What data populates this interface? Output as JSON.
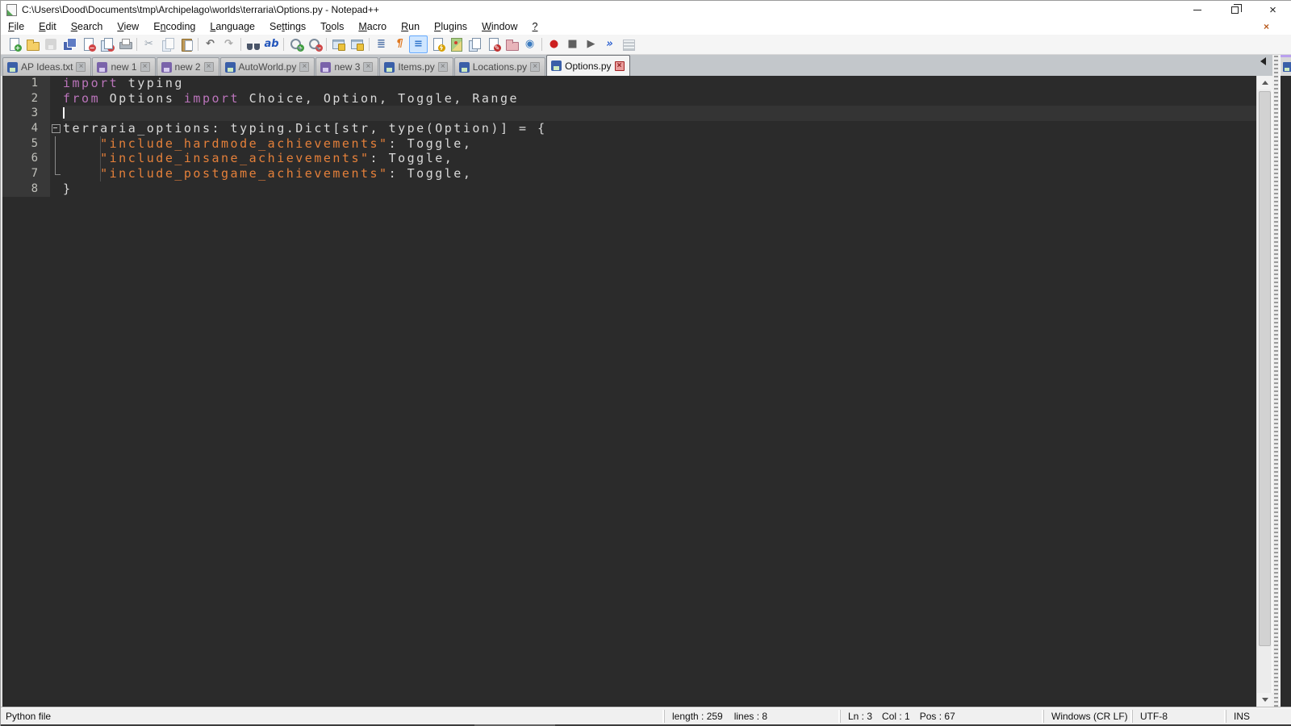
{
  "window": {
    "title": "C:\\Users\\Dood\\Documents\\tmp\\Archipelago\\worlds\\terraria\\Options.py - Notepad++"
  },
  "menu": {
    "items": [
      {
        "label": "File",
        "m": 0
      },
      {
        "label": "Edit",
        "m": 0
      },
      {
        "label": "Search",
        "m": 0
      },
      {
        "label": "View",
        "m": 0
      },
      {
        "label": "Encoding",
        "m": 1
      },
      {
        "label": "Language",
        "m": 0
      },
      {
        "label": "Settings",
        "m": 2
      },
      {
        "label": "Tools",
        "m": 1
      },
      {
        "label": "Macro",
        "m": 0
      },
      {
        "label": "Run",
        "m": 0
      },
      {
        "label": "Plugins",
        "m": 0
      },
      {
        "label": "Window",
        "m": 0
      },
      {
        "label": "?",
        "m": 0
      }
    ],
    "close_x": "×"
  },
  "toolbar": {
    "groups": [
      [
        {
          "id": "new-file",
          "k": "page",
          "b": "+",
          "bc": "#3f9e3f"
        },
        {
          "id": "open-file",
          "k": "folder"
        },
        {
          "id": "save",
          "k": "floppy gray",
          "disabled": true
        },
        {
          "id": "save-all",
          "k": "floppies"
        },
        {
          "id": "close-file",
          "k": "page",
          "b": "−",
          "bc": "#d04545"
        },
        {
          "id": "close-all-files",
          "k": "pages",
          "b": "−",
          "bc": "#d04545"
        },
        {
          "id": "print",
          "k": "printer"
        }
      ],
      [
        {
          "id": "cut",
          "k": "glyph",
          "g": "✂",
          "col": "#98a4b0"
        },
        {
          "id": "copy",
          "k": "pages",
          "disabled": true
        },
        {
          "id": "paste",
          "k": "clipboard"
        }
      ],
      [
        {
          "id": "undo",
          "k": "glyph",
          "g": "↶",
          "col": "#6e6e6e"
        },
        {
          "id": "redo",
          "k": "glyph",
          "g": "↷",
          "col": "#aaaaaa"
        }
      ],
      [
        {
          "id": "find",
          "k": "binoc"
        },
        {
          "id": "replace",
          "k": "glyph",
          "g": "ab",
          "col": "#2255bb"
        }
      ],
      [
        {
          "id": "zoom-in",
          "k": "zoom",
          "b": "+",
          "bc": "#3f9e3f"
        },
        {
          "id": "zoom-out",
          "k": "zoom",
          "b": "−",
          "bc": "#d04545"
        }
      ],
      [
        {
          "id": "sync-vertical-scrolling",
          "k": "winlock"
        },
        {
          "id": "sync-horizontal-scrolling",
          "k": "winlock"
        }
      ],
      [
        {
          "id": "word-wrap",
          "k": "glyph",
          "g": "≣",
          "col": "#5577aa"
        },
        {
          "id": "show-all-characters",
          "k": "glyph",
          "g": "¶",
          "col": "#e07820"
        },
        {
          "id": "show-indent-guide",
          "k": "glyph",
          "g": "≡",
          "col": "#3377cc",
          "active": true
        },
        {
          "id": "function-list",
          "k": "page",
          "b": "ϟ",
          "bc": "#d7a000"
        },
        {
          "id": "document-map",
          "k": "map"
        },
        {
          "id": "document-list",
          "k": "pages"
        },
        {
          "id": "document-edit",
          "k": "page",
          "b": "✎",
          "bc": "#c03030"
        },
        {
          "id": "folder-as-workspace",
          "k": "folder2"
        },
        {
          "id": "monitoring",
          "k": "glyph",
          "g": "◉",
          "col": "#3a7abf"
        }
      ],
      [
        {
          "id": "start-recording",
          "k": "glyph",
          "g": "●",
          "col": "#cc2020"
        },
        {
          "id": "stop-recording",
          "k": "glyph",
          "g": "■",
          "col": "#606060"
        },
        {
          "id": "playback",
          "k": "glyph",
          "g": "▶",
          "col": "#606060"
        },
        {
          "id": "run-macro-multiple-times",
          "k": "glyph",
          "g": "»",
          "col": "#2a5fd0"
        },
        {
          "id": "save-recorded-macro",
          "k": "grid",
          "disabled": true
        }
      ]
    ]
  },
  "tabbar": {
    "tabs": [
      {
        "label": "AP Ideas.txt",
        "state": "saved",
        "active": false
      },
      {
        "label": "new 1",
        "state": "modified",
        "active": false
      },
      {
        "label": "new 2",
        "state": "modified",
        "active": false
      },
      {
        "label": "AutoWorld.py",
        "state": "saved",
        "active": false
      },
      {
        "label": "new 3",
        "state": "modified",
        "active": false
      },
      {
        "label": "Items.py",
        "state": "saved",
        "active": false
      },
      {
        "label": "Locations.py",
        "state": "saved",
        "active": false
      },
      {
        "label": "Options.py",
        "state": "saved",
        "active": true
      }
    ],
    "close_glyph": "×"
  },
  "editor": {
    "colors": {
      "keyword": "#bb74bb",
      "string": "#e5803a",
      "default": "#d9d9d9",
      "background": "#2b2b2b",
      "gutter_background": "#383838",
      "line_number": "#c0c0ba"
    },
    "lines": [
      {
        "num": "1",
        "segments": [
          {
            "t": "import",
            "c": "k"
          },
          {
            "t": " typing",
            "c": "d"
          }
        ]
      },
      {
        "num": "2",
        "segments": [
          {
            "t": "from",
            "c": "k"
          },
          {
            "t": " Options ",
            "c": "d"
          },
          {
            "t": "import",
            "c": "k"
          },
          {
            "t": " Choice, Option, Toggle, Range",
            "c": "d"
          }
        ]
      },
      {
        "num": "3",
        "segments": [],
        "caret": true,
        "cur": true
      },
      {
        "num": "4",
        "fold": "open",
        "segments": [
          {
            "t": "terraria_options: typing.Dict[str, type(Option)] = {",
            "c": "d"
          }
        ]
      },
      {
        "num": "5",
        "fold": "line",
        "guide": true,
        "segments": [
          {
            "t": "    ",
            "c": "d"
          },
          {
            "t": "\"include_hardmode_achievements\"",
            "c": "s"
          },
          {
            "t": ": Toggle,",
            "c": "d"
          }
        ]
      },
      {
        "num": "6",
        "fold": "line",
        "guide": true,
        "segments": [
          {
            "t": "    ",
            "c": "d"
          },
          {
            "t": "\"include_insane_achievements\"",
            "c": "s"
          },
          {
            "t": ": Toggle,",
            "c": "d"
          }
        ]
      },
      {
        "num": "7",
        "fold": "end",
        "guide": true,
        "segments": [
          {
            "t": "    ",
            "c": "d"
          },
          {
            "t": "\"include_postgame_achievements\"",
            "c": "s"
          },
          {
            "t": ": Toggle,",
            "c": "d"
          }
        ]
      },
      {
        "num": "8",
        "segments": [
          {
            "t": "}",
            "c": "d"
          }
        ]
      }
    ]
  },
  "status_bar": {
    "doc_type": "Python file",
    "length": "length : 259",
    "lines": "lines : 8",
    "ln": "Ln : 3",
    "col": "Col : 1",
    "pos": "Pos : 67",
    "eol": "Windows (CR LF)",
    "encoding": "UTF-8",
    "insert_mode": "INS"
  }
}
